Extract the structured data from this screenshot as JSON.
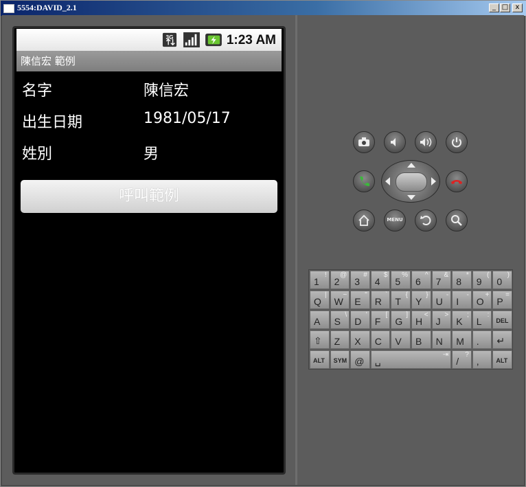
{
  "window": {
    "title": "5554:DAVID_2.1",
    "min_label": "_",
    "max_label": "□",
    "close_label": "x"
  },
  "status_bar": {
    "time": "1:23 AM",
    "network_label": "3G"
  },
  "app": {
    "title": "陳信宏 範例",
    "fields": [
      {
        "label": "名字",
        "value": "陳信宏"
      },
      {
        "label": "出生日期",
        "value": "1981/05/17"
      },
      {
        "label": "姓別",
        "value": "男"
      }
    ],
    "call_button": "呼叫範例"
  },
  "controls": {
    "menu_label": "MENU"
  },
  "keyboard": {
    "rows": [
      [
        {
          "m": "1",
          "s": "!"
        },
        {
          "m": "2",
          "s": "@"
        },
        {
          "m": "3",
          "s": "#"
        },
        {
          "m": "4",
          "s": "$"
        },
        {
          "m": "5",
          "s": "%"
        },
        {
          "m": "6",
          "s": "^"
        },
        {
          "m": "7",
          "s": "&"
        },
        {
          "m": "8",
          "s": "*"
        },
        {
          "m": "9",
          "s": "("
        },
        {
          "m": "0",
          "s": ")"
        }
      ],
      [
        {
          "m": "Q",
          "s": "|"
        },
        {
          "m": "W",
          "s": "~"
        },
        {
          "m": "E",
          "s": "\""
        },
        {
          "m": "R",
          "s": "`"
        },
        {
          "m": "T",
          "s": "{"
        },
        {
          "m": "Y",
          "s": "}"
        },
        {
          "m": "U",
          "s": "-"
        },
        {
          "m": "I",
          "s": "-"
        },
        {
          "m": "O",
          "s": "+"
        },
        {
          "m": "P",
          "s": "="
        }
      ],
      [
        {
          "m": "A",
          "s": ""
        },
        {
          "m": "S",
          "s": "\\"
        },
        {
          "m": "D",
          "s": "'"
        },
        {
          "m": "F",
          "s": "["
        },
        {
          "m": "G",
          "s": "]"
        },
        {
          "m": "H",
          "s": "<"
        },
        {
          "m": "J",
          "s": ">"
        },
        {
          "m": "K",
          "s": ";"
        },
        {
          "m": "L",
          "s": ":"
        },
        {
          "m": "DEL",
          "s": ""
        }
      ],
      [
        {
          "m": "⇧",
          "s": ""
        },
        {
          "m": "Z",
          "s": ""
        },
        {
          "m": "X",
          "s": ""
        },
        {
          "m": "C",
          "s": ""
        },
        {
          "m": "V",
          "s": ""
        },
        {
          "m": "B",
          "s": ""
        },
        {
          "m": "N",
          "s": ""
        },
        {
          "m": "M",
          "s": ""
        },
        {
          "m": ".",
          "s": ""
        },
        {
          "m": "↵",
          "s": ""
        }
      ],
      [
        {
          "m": "ALT",
          "s": ""
        },
        {
          "m": "SYM",
          "s": ""
        },
        {
          "m": "@",
          "s": ""
        },
        {
          "m": "␣",
          "s": "⇥"
        },
        {
          "m": "/",
          "s": "?"
        },
        {
          "m": ",",
          "s": ""
        },
        {
          "m": "ALT",
          "s": ""
        }
      ]
    ]
  }
}
